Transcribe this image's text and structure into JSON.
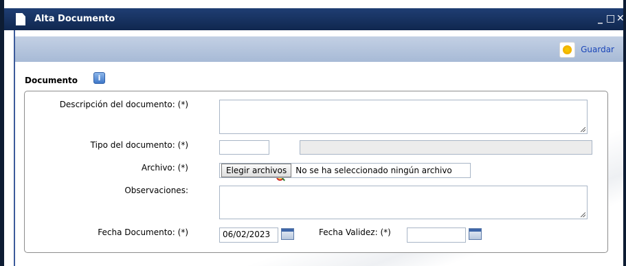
{
  "window": {
    "title": "Alta Documento",
    "controls": [
      "_",
      "□",
      "✕"
    ]
  },
  "toolbar": {
    "save_label": "Guardar"
  },
  "section": {
    "label": "Documento"
  },
  "form": {
    "descripcion_label": "Descripción del documento: (*)",
    "descripcion_value": "",
    "tipo_label": "Tipo del documento: (*)",
    "tipo_code": "",
    "tipo_desc": "",
    "archivo_label": "Archivo: (*)",
    "archivo_button": "Elegir archivos",
    "archivo_status": "No se ha seleccionado ningún archivo",
    "observaciones_label": "Observaciones:",
    "observaciones_value": "",
    "fecha_doc_label": "Fecha Documento: (*)",
    "fecha_doc_value": "06/02/2023",
    "fecha_validez_label": "Fecha Validez: (*)",
    "fecha_validez_value": ""
  }
}
